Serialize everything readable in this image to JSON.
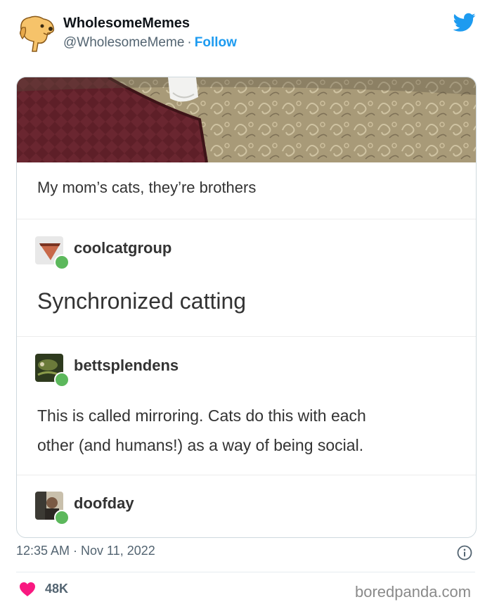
{
  "tweet": {
    "display_name": "WholesomeMemes",
    "handle": "@WholesomeMeme",
    "separator": "·",
    "follow_label": "Follow",
    "timestamp": "12:35 AM · Nov 11, 2022",
    "likes": "48K",
    "twitter_icon": "twitter-bird-icon",
    "colors": {
      "accent": "#1d9bf0",
      "heart": "#f91880",
      "muted": "#536471"
    }
  },
  "post": {
    "caption": "My mom’s cats, they’re brothers",
    "reblogs": [
      {
        "user": "coolcatgroup",
        "text": "Synchronized catting"
      },
      {
        "user": "bettsplendens",
        "text_lines": [
          "This is called mirroring. Cats do this with each",
          "other (and humans!) as a way of being social."
        ]
      },
      {
        "user": "doofday"
      }
    ]
  },
  "watermark": "boredpanda.com"
}
